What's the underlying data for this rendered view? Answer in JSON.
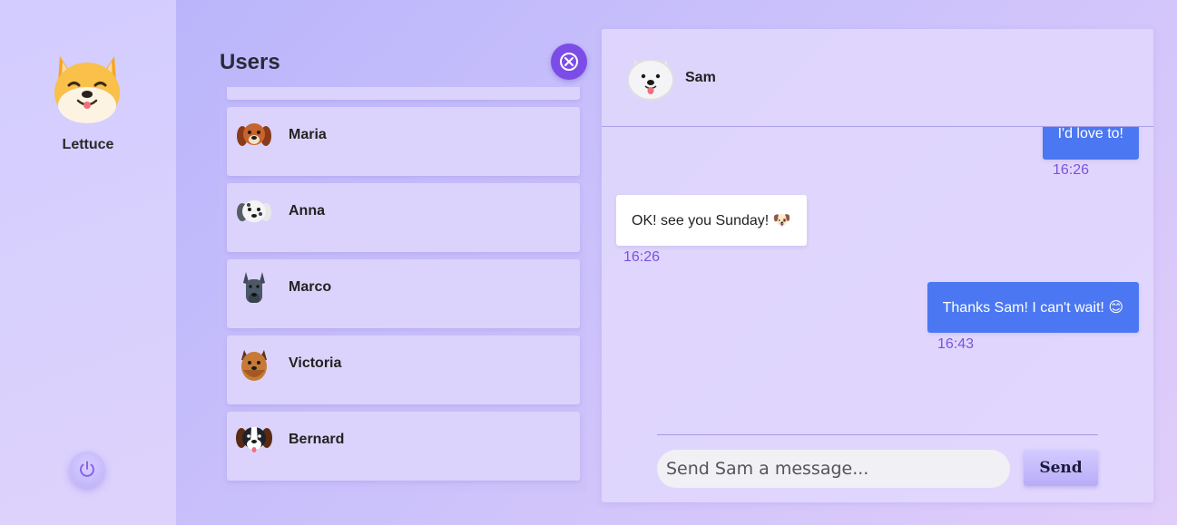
{
  "profile": {
    "name": "Lettuce",
    "avatar_icon": "shiba-dog-icon"
  },
  "users_panel": {
    "title": "Users",
    "users": [
      {
        "name": "Maria",
        "avatar_icon": "brown-spaniel-icon"
      },
      {
        "name": "Anna",
        "avatar_icon": "dalmatian-icon"
      },
      {
        "name": "Marco",
        "avatar_icon": "great-dane-icon"
      },
      {
        "name": "Victoria",
        "avatar_icon": "yorkie-icon"
      },
      {
        "name": "Bernard",
        "avatar_icon": "saint-bernard-icon"
      }
    ]
  },
  "chat": {
    "contact_name": "Sam",
    "contact_avatar_icon": "samoyed-icon",
    "messages": [
      {
        "from": "me",
        "text": "I'd love to!",
        "time": "16:26"
      },
      {
        "from": "them",
        "text": "OK! see you Sunday!",
        "emoji": "🐶",
        "time": "16:26"
      },
      {
        "from": "me",
        "text": "Thanks Sam! I can't wait!",
        "emoji": "😊",
        "time": "16:43"
      }
    ],
    "input_placeholder": "Send Sam a message...",
    "send_label": "Send"
  },
  "colors": {
    "accent": "#7b4de6",
    "my_bubble": "#4b78f2",
    "timestamp": "#7a52e0"
  }
}
